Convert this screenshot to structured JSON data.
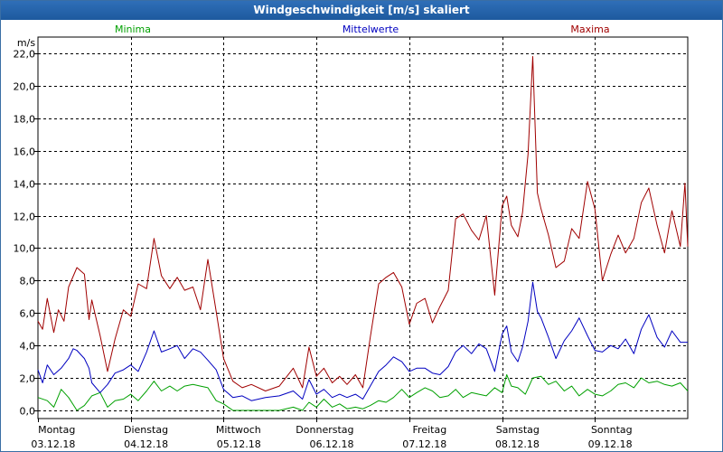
{
  "window": {
    "title": "Windgeschwindigkeit [m/s] skaliert"
  },
  "chart_data": {
    "type": "line",
    "title": "Windgeschwindigkeit [m/s] skaliert",
    "ylabel": "m/s",
    "ylim": [
      -0.5,
      23.0
    ],
    "yticks": [
      "0,0",
      "2,0",
      "4,0",
      "6,0",
      "8,0",
      "10,0",
      "12,0",
      "14,0",
      "16,0",
      "18,0",
      "20,0",
      "22,0"
    ],
    "ytick_values": [
      0,
      2,
      4,
      6,
      8,
      10,
      12,
      14,
      16,
      18,
      20,
      22
    ],
    "xlim": [
      0,
      7.0
    ],
    "grid": true,
    "days": [
      {
        "weekday": "Montag",
        "date": "03.12.18"
      },
      {
        "weekday": "Dienstag",
        "date": "04.12.18"
      },
      {
        "weekday": "Mittwoch",
        "date": "05.12.18"
      },
      {
        "weekday": "Donnerstag",
        "date": "06.12.18"
      },
      {
        "weekday": "Freitag",
        "date": "07.12.18"
      },
      {
        "weekday": "Samstag",
        "date": "08.12.18"
      },
      {
        "weekday": "Sonntag",
        "date": "09.12.18"
      }
    ],
    "series": [
      {
        "name": "Minima",
        "color": "#00a000",
        "points": [
          [
            0.0,
            0.8
          ],
          [
            0.1,
            0.6
          ],
          [
            0.17,
            0.2
          ],
          [
            0.25,
            1.3
          ],
          [
            0.33,
            0.8
          ],
          [
            0.42,
            0.0
          ],
          [
            0.5,
            0.3
          ],
          [
            0.58,
            0.9
          ],
          [
            0.67,
            1.1
          ],
          [
            0.75,
            0.2
          ],
          [
            0.83,
            0.6
          ],
          [
            0.92,
            0.7
          ],
          [
            1.0,
            1.0
          ],
          [
            1.08,
            0.6
          ],
          [
            1.17,
            1.2
          ],
          [
            1.25,
            1.8
          ],
          [
            1.33,
            1.2
          ],
          [
            1.42,
            1.5
          ],
          [
            1.5,
            1.2
          ],
          [
            1.58,
            1.5
          ],
          [
            1.67,
            1.6
          ],
          [
            1.75,
            1.5
          ],
          [
            1.83,
            1.4
          ],
          [
            1.92,
            0.6
          ],
          [
            2.0,
            0.4
          ],
          [
            2.1,
            0.0
          ],
          [
            2.2,
            0.0
          ],
          [
            2.3,
            0.0
          ],
          [
            2.45,
            0.0
          ],
          [
            2.6,
            0.0
          ],
          [
            2.75,
            0.2
          ],
          [
            2.85,
            0.0
          ],
          [
            2.92,
            0.5
          ],
          [
            3.0,
            0.2
          ],
          [
            3.08,
            0.7
          ],
          [
            3.17,
            0.2
          ],
          [
            3.25,
            0.4
          ],
          [
            3.33,
            0.1
          ],
          [
            3.42,
            0.2
          ],
          [
            3.5,
            0.1
          ],
          [
            3.58,
            0.3
          ],
          [
            3.67,
            0.6
          ],
          [
            3.75,
            0.5
          ],
          [
            3.83,
            0.8
          ],
          [
            3.92,
            1.3
          ],
          [
            4.0,
            0.8
          ],
          [
            4.08,
            1.1
          ],
          [
            4.17,
            1.4
          ],
          [
            4.25,
            1.2
          ],
          [
            4.33,
            0.8
          ],
          [
            4.42,
            0.9
          ],
          [
            4.5,
            1.3
          ],
          [
            4.58,
            0.8
          ],
          [
            4.67,
            1.1
          ],
          [
            4.75,
            1.0
          ],
          [
            4.83,
            0.9
          ],
          [
            4.92,
            1.4
          ],
          [
            5.0,
            1.1
          ],
          [
            5.05,
            2.2
          ],
          [
            5.1,
            1.5
          ],
          [
            5.17,
            1.4
          ],
          [
            5.25,
            1.0
          ],
          [
            5.33,
            2.0
          ],
          [
            5.42,
            2.1
          ],
          [
            5.5,
            1.6
          ],
          [
            5.58,
            1.8
          ],
          [
            5.67,
            1.2
          ],
          [
            5.75,
            1.5
          ],
          [
            5.83,
            0.9
          ],
          [
            5.92,
            1.3
          ],
          [
            6.0,
            1.0
          ],
          [
            6.08,
            0.9
          ],
          [
            6.17,
            1.2
          ],
          [
            6.25,
            1.6
          ],
          [
            6.33,
            1.7
          ],
          [
            6.42,
            1.4
          ],
          [
            6.5,
            2.0
          ],
          [
            6.58,
            1.7
          ],
          [
            6.67,
            1.8
          ],
          [
            6.75,
            1.6
          ],
          [
            6.83,
            1.5
          ],
          [
            6.92,
            1.7
          ],
          [
            7.0,
            1.2
          ]
        ]
      },
      {
        "name": "Mittelwerte",
        "color": "#0000c0",
        "points": [
          [
            0.0,
            2.5
          ],
          [
            0.05,
            1.7
          ],
          [
            0.1,
            2.8
          ],
          [
            0.17,
            2.2
          ],
          [
            0.25,
            2.6
          ],
          [
            0.33,
            3.2
          ],
          [
            0.38,
            3.8
          ],
          [
            0.42,
            3.7
          ],
          [
            0.5,
            3.2
          ],
          [
            0.55,
            2.6
          ],
          [
            0.58,
            1.7
          ],
          [
            0.67,
            1.1
          ],
          [
            0.75,
            1.6
          ],
          [
            0.83,
            2.3
          ],
          [
            0.92,
            2.5
          ],
          [
            1.0,
            2.8
          ],
          [
            1.08,
            2.4
          ],
          [
            1.17,
            3.6
          ],
          [
            1.25,
            4.9
          ],
          [
            1.33,
            3.6
          ],
          [
            1.42,
            3.8
          ],
          [
            1.5,
            4.0
          ],
          [
            1.58,
            3.2
          ],
          [
            1.67,
            3.8
          ],
          [
            1.75,
            3.6
          ],
          [
            1.83,
            3.1
          ],
          [
            1.92,
            2.5
          ],
          [
            2.0,
            1.3
          ],
          [
            2.1,
            0.8
          ],
          [
            2.2,
            0.9
          ],
          [
            2.3,
            0.6
          ],
          [
            2.45,
            0.8
          ],
          [
            2.6,
            0.9
          ],
          [
            2.75,
            1.2
          ],
          [
            2.85,
            0.7
          ],
          [
            2.92,
            1.9
          ],
          [
            3.0,
            1.0
          ],
          [
            3.08,
            1.3
          ],
          [
            3.17,
            0.8
          ],
          [
            3.25,
            1.0
          ],
          [
            3.33,
            0.8
          ],
          [
            3.42,
            1.0
          ],
          [
            3.5,
            0.7
          ],
          [
            3.58,
            1.5
          ],
          [
            3.67,
            2.4
          ],
          [
            3.75,
            2.8
          ],
          [
            3.83,
            3.3
          ],
          [
            3.92,
            3.0
          ],
          [
            4.0,
            2.4
          ],
          [
            4.08,
            2.6
          ],
          [
            4.17,
            2.6
          ],
          [
            4.25,
            2.3
          ],
          [
            4.33,
            2.2
          ],
          [
            4.42,
            2.7
          ],
          [
            4.5,
            3.6
          ],
          [
            4.58,
            4.0
          ],
          [
            4.67,
            3.5
          ],
          [
            4.75,
            4.1
          ],
          [
            4.83,
            3.8
          ],
          [
            4.92,
            2.4
          ],
          [
            5.0,
            4.7
          ],
          [
            5.05,
            5.2
          ],
          [
            5.1,
            3.6
          ],
          [
            5.17,
            3.0
          ],
          [
            5.22,
            3.9
          ],
          [
            5.28,
            5.5
          ],
          [
            5.33,
            7.9
          ],
          [
            5.38,
            6.1
          ],
          [
            5.42,
            5.7
          ],
          [
            5.5,
            4.5
          ],
          [
            5.58,
            3.2
          ],
          [
            5.67,
            4.3
          ],
          [
            5.75,
            4.9
          ],
          [
            5.83,
            5.7
          ],
          [
            5.92,
            4.6
          ],
          [
            6.0,
            3.7
          ],
          [
            6.08,
            3.6
          ],
          [
            6.17,
            4.0
          ],
          [
            6.25,
            3.8
          ],
          [
            6.33,
            4.4
          ],
          [
            6.42,
            3.5
          ],
          [
            6.5,
            5.0
          ],
          [
            6.58,
            5.9
          ],
          [
            6.67,
            4.5
          ],
          [
            6.75,
            3.9
          ],
          [
            6.83,
            4.9
          ],
          [
            6.92,
            4.2
          ],
          [
            7.0,
            4.2
          ]
        ]
      },
      {
        "name": "Maxima",
        "color": "#a00000",
        "points": [
          [
            0.0,
            5.5
          ],
          [
            0.05,
            5.0
          ],
          [
            0.1,
            6.9
          ],
          [
            0.17,
            4.8
          ],
          [
            0.22,
            6.2
          ],
          [
            0.28,
            5.5
          ],
          [
            0.33,
            7.6
          ],
          [
            0.42,
            8.8
          ],
          [
            0.5,
            8.4
          ],
          [
            0.55,
            5.6
          ],
          [
            0.58,
            6.8
          ],
          [
            0.67,
            4.6
          ],
          [
            0.75,
            2.4
          ],
          [
            0.83,
            4.4
          ],
          [
            0.92,
            6.2
          ],
          [
            1.0,
            5.8
          ],
          [
            1.08,
            7.8
          ],
          [
            1.17,
            7.5
          ],
          [
            1.25,
            10.6
          ],
          [
            1.33,
            8.3
          ],
          [
            1.42,
            7.5
          ],
          [
            1.5,
            8.2
          ],
          [
            1.58,
            7.4
          ],
          [
            1.67,
            7.6
          ],
          [
            1.75,
            6.2
          ],
          [
            1.83,
            9.3
          ],
          [
            1.92,
            6.1
          ],
          [
            2.0,
            3.2
          ],
          [
            2.1,
            1.8
          ],
          [
            2.2,
            1.4
          ],
          [
            2.3,
            1.6
          ],
          [
            2.45,
            1.2
          ],
          [
            2.6,
            1.5
          ],
          [
            2.75,
            2.6
          ],
          [
            2.85,
            1.4
          ],
          [
            2.92,
            3.9
          ],
          [
            3.0,
            2.1
          ],
          [
            3.08,
            2.6
          ],
          [
            3.17,
            1.7
          ],
          [
            3.25,
            2.1
          ],
          [
            3.33,
            1.6
          ],
          [
            3.42,
            2.2
          ],
          [
            3.5,
            1.4
          ],
          [
            3.58,
            4.5
          ],
          [
            3.67,
            7.8
          ],
          [
            3.75,
            8.2
          ],
          [
            3.83,
            8.5
          ],
          [
            3.92,
            7.6
          ],
          [
            4.0,
            5.3
          ],
          [
            4.08,
            6.6
          ],
          [
            4.17,
            6.9
          ],
          [
            4.25,
            5.4
          ],
          [
            4.33,
            6.4
          ],
          [
            4.42,
            7.4
          ],
          [
            4.5,
            11.8
          ],
          [
            4.58,
            12.1
          ],
          [
            4.67,
            11.1
          ],
          [
            4.75,
            10.5
          ],
          [
            4.83,
            12.0
          ],
          [
            4.92,
            7.1
          ],
          [
            5.0,
            12.6
          ],
          [
            5.05,
            13.2
          ],
          [
            5.1,
            11.4
          ],
          [
            5.17,
            10.7
          ],
          [
            5.22,
            12.2
          ],
          [
            5.28,
            15.8
          ],
          [
            5.33,
            21.8
          ],
          [
            5.38,
            13.4
          ],
          [
            5.42,
            12.4
          ],
          [
            5.5,
            10.8
          ],
          [
            5.58,
            8.8
          ],
          [
            5.67,
            9.2
          ],
          [
            5.75,
            11.2
          ],
          [
            5.83,
            10.6
          ],
          [
            5.92,
            14.1
          ],
          [
            6.0,
            12.4
          ],
          [
            6.08,
            8.0
          ],
          [
            6.17,
            9.6
          ],
          [
            6.25,
            10.8
          ],
          [
            6.33,
            9.7
          ],
          [
            6.42,
            10.6
          ],
          [
            6.5,
            12.8
          ],
          [
            6.58,
            13.7
          ],
          [
            6.67,
            11.4
          ],
          [
            6.75,
            9.7
          ],
          [
            6.83,
            12.3
          ],
          [
            6.92,
            10.1
          ],
          [
            6.97,
            14.0
          ],
          [
            7.0,
            10.1
          ]
        ]
      }
    ]
  }
}
